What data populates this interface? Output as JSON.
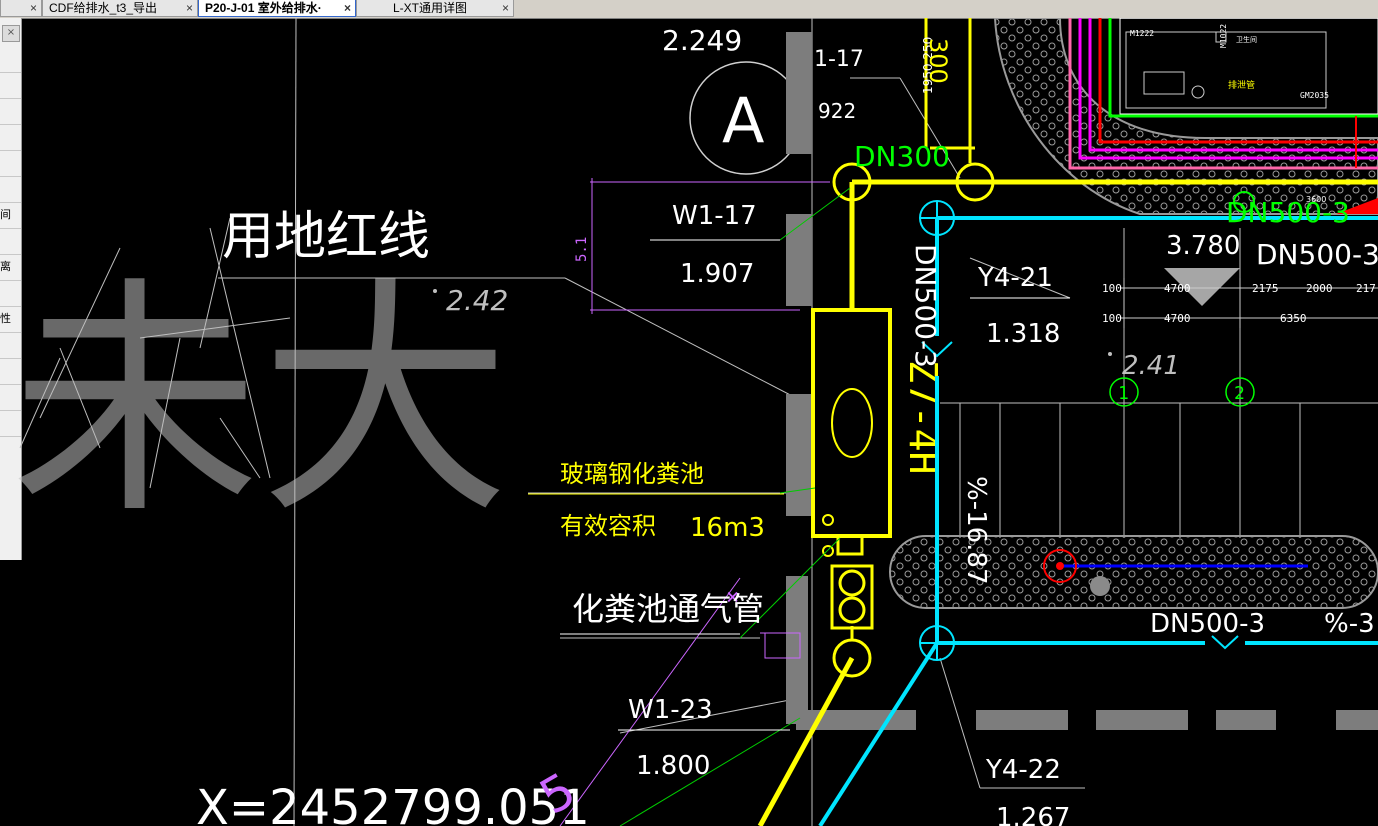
{
  "tabs": [
    {
      "label": "",
      "active": false
    },
    {
      "label": "CDF给排水_t3_导出",
      "active": false
    },
    {
      "label": "P20-J-01 室外给排水·",
      "active": true
    },
    {
      "label": "L-XT通用详图",
      "active": false
    }
  ],
  "tab_close": "×",
  "left_panel": {
    "close": "×",
    "items": [
      "",
      "",
      "",
      "",
      "",
      "",
      "间",
      "",
      "离",
      "",
      "性",
      "",
      "",
      "",
      ""
    ]
  },
  "drawing": {
    "elev_top": "2.249",
    "axis_A": "A",
    "label_1_17": "1-17",
    "num_922": "922",
    "dims_vertical": "1950 250",
    "dn300_top": "300",
    "dn300": "DN300",
    "red_line_label": "用地红线",
    "dot_242": "2.42",
    "dim_51": "5.1",
    "w1_17": "W1-17",
    "w1_17_elev": "1.907",
    "dn500_3_vert": "DN500-3",
    "y4_21": "Y4-21",
    "y4_21_elev": "1.318",
    "elev_3780": "3.780",
    "dn500_3_right": "DN500-3",
    "dn500_3_top": "DN500-3",
    "dim_3600": "3600",
    "dims_row1": [
      "100",
      "4700",
      "2175",
      "2000",
      "217"
    ],
    "dims_row2": [
      "100",
      "4700",
      "6350"
    ],
    "dot_241": "2.41",
    "axis_1": "1",
    "axis_2": "2",
    "tank_code": "Z7-4H",
    "slope_168": "%-16.87",
    "septic_label": "玻璃钢化粪池",
    "volume_label": "有效容积",
    "volume_value": "16m3",
    "vent_label": "化粪池通气管",
    "dn500_3_bottom": "DN500-3",
    "slope_bottom": "%-3",
    "w1_23": "W1-23",
    "w1_23_elev": "1.800",
    "y4_22": "Y4-22",
    "y4_22_elev": "1.267",
    "coord_x": "X=2452799.051",
    "num_5": "5",
    "big_char": "未大",
    "bldg_labels": [
      "M1222",
      "M1022",
      "GM2035",
      "排泄管",
      "卫生间"
    ]
  },
  "colors": {
    "yellow": "#ffff00",
    "cyan": "#00e5ff",
    "magenta": "#ff00ff",
    "red": "#ff0000",
    "green": "#00ff00",
    "blue": "#0000ff",
    "pink": "#ff66aa",
    "gray": "#808080",
    "white": "#ffffff",
    "lilac": "#cc66ff"
  }
}
